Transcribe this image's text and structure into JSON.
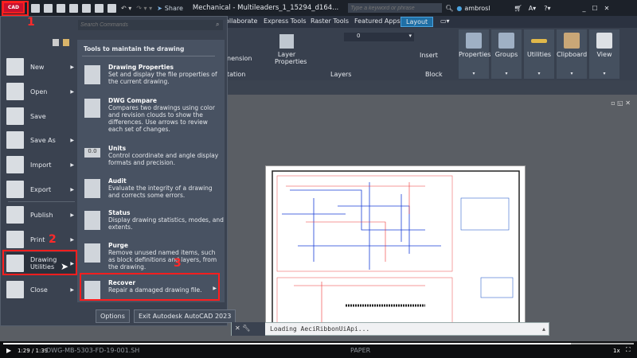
{
  "titlebar": {
    "logo": "CAD",
    "share": "Share",
    "title": "Mechanical - Multileaders_1_15294_d164...",
    "search_placeholder": "Type a keyword or phrase",
    "user": "ambrosl"
  },
  "tabs": [
    "ollaborate",
    "Express Tools",
    "Raster Tools",
    "Featured Apps",
    "Layout"
  ],
  "ribbon": {
    "dimension": "nension",
    "annotation": "tation",
    "layer_properties": "Layer Properties",
    "layer_value": "0",
    "layers": "Layers",
    "insert": "Insert",
    "block": "Block",
    "panels": [
      "Properties",
      "Groups",
      "Utilities",
      "Clipboard",
      "View"
    ]
  },
  "menu": {
    "search_placeholder": "Search Commands",
    "left_items": [
      "New",
      "Open",
      "Save",
      "Save As",
      "Import",
      "Export",
      "Publish",
      "Print",
      "Drawing Utilities",
      "Close"
    ],
    "section_title": "Tools to maintain the drawing",
    "tools": [
      {
        "title": "Drawing Properties",
        "desc": "Set and display the file properties of the current drawing."
      },
      {
        "title": "DWG Compare",
        "desc": "Compares two drawings using color and revision clouds to show the differences. Use arrows to review each set of changes."
      },
      {
        "title": "Units",
        "desc": "Control coordinate and angle display formats and precision.",
        "icon_text": "0.0"
      },
      {
        "title": "Audit",
        "desc": "Evaluate the integrity of a drawing and corrects some errors."
      },
      {
        "title": "Status",
        "desc": "Display drawing statistics, modes, and extents."
      },
      {
        "title": "Purge",
        "desc": "Remove unused named items, such as block definitions and layers, from the drawing."
      },
      {
        "title": "Recover",
        "desc": "Repair a damaged drawing file."
      }
    ],
    "options": "Options",
    "exit": "Exit Autodesk AutoCAD 2023"
  },
  "annotations": [
    "1",
    "2",
    "3"
  ],
  "command_line": "Loading AeciRibbonUiApi...",
  "status": {
    "file": "DWG-MB-5303-FD-19-001.SH",
    "paper": "PAPER"
  },
  "video": {
    "time": "1:29 / 1:39",
    "speed": "1x",
    "progress": 0.9
  },
  "colors": {
    "accent": "#1f6fa5",
    "highlight": "#ff1e1e",
    "logo": "#c8102e"
  }
}
